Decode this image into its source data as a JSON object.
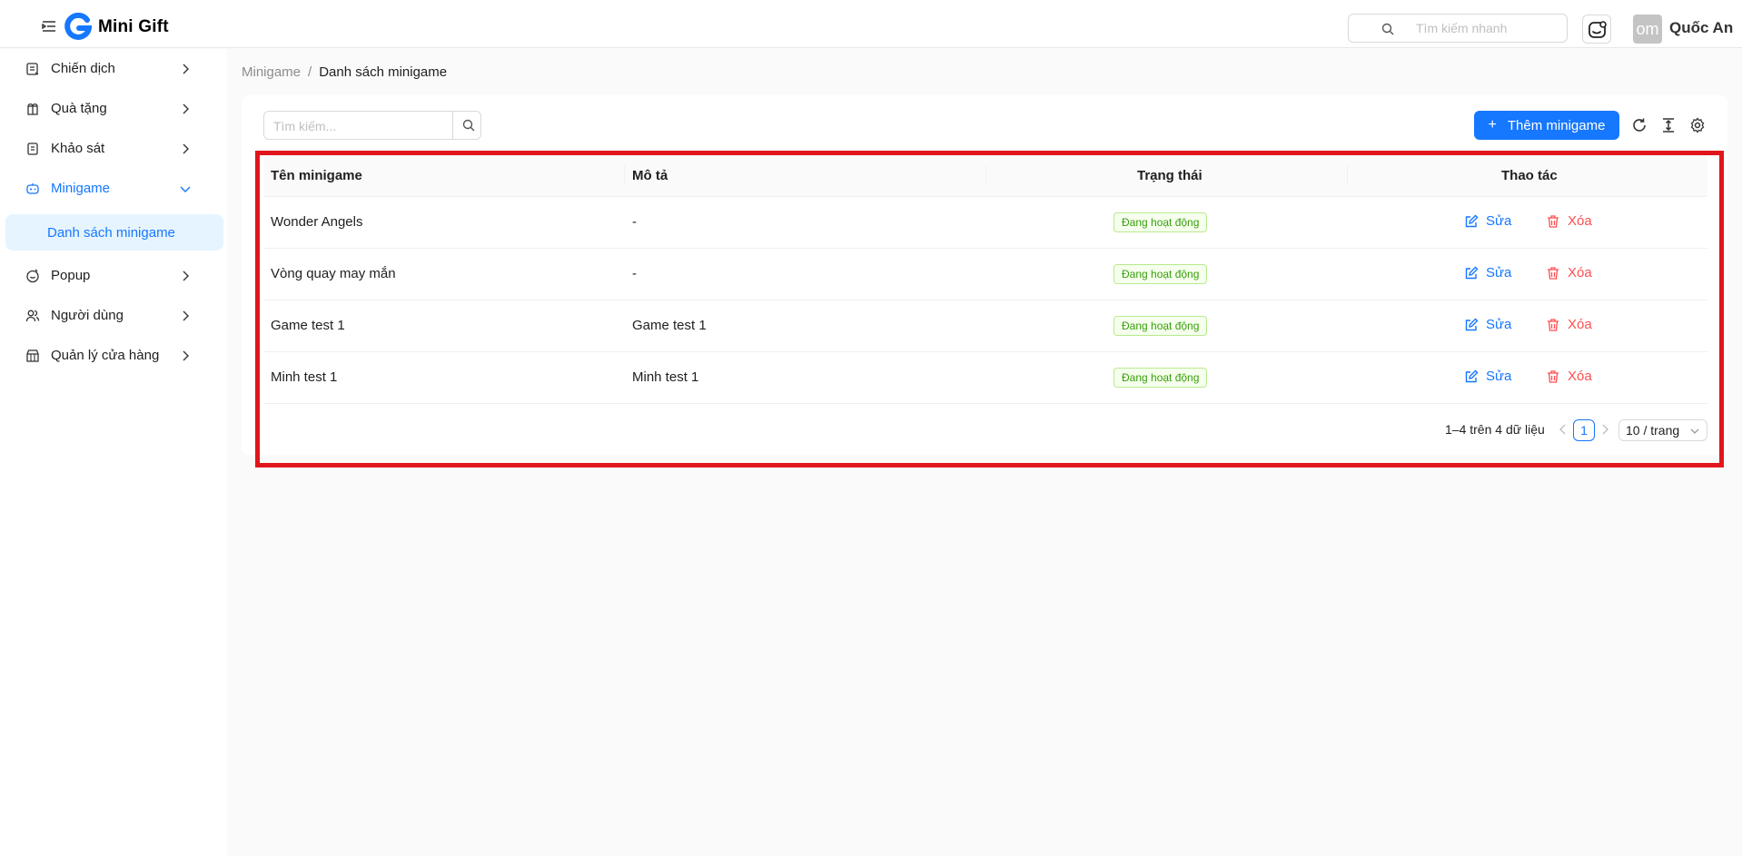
{
  "header": {
    "app_title": "Mini Gift",
    "quick_search_placeholder": "Tìm kiếm nhanh",
    "avatar_initials": "om",
    "user_name": "Quốc An"
  },
  "sidebar": {
    "items": [
      {
        "label": "Chiến dịch",
        "icon": "campaign-icon"
      },
      {
        "label": "Quà tặng",
        "icon": "gift-icon"
      },
      {
        "label": "Khảo sát",
        "icon": "survey-icon"
      },
      {
        "label": "Minigame",
        "icon": "game-icon",
        "active": true,
        "expanded": true
      },
      {
        "label": "Popup",
        "icon": "popup-icon"
      },
      {
        "label": "Người dùng",
        "icon": "users-icon"
      },
      {
        "label": "Quản lý cửa hàng",
        "icon": "store-icon"
      }
    ],
    "sub_item": "Danh sách minigame"
  },
  "breadcrumb": {
    "parent": "Minigame",
    "separator": "/",
    "current": "Danh sách minigame"
  },
  "toolbar": {
    "search_placeholder": "Tìm kiếm...",
    "add_label": "Thêm minigame",
    "add_symbol": "+"
  },
  "table": {
    "columns": [
      "Tên minigame",
      "Mô tả",
      "Trạng thái",
      "Thao tác"
    ],
    "rows": [
      {
        "name": "Wonder Angels",
        "description": "-",
        "status": "Đang hoạt động"
      },
      {
        "name": "Vòng quay may mắn",
        "description": "-",
        "status": "Đang hoạt động"
      },
      {
        "name": "Game test 1",
        "description": "Game test 1",
        "status": "Đang hoạt động"
      },
      {
        "name": "Minh test 1",
        "description": "Minh test 1",
        "status": "Đang hoạt động"
      }
    ],
    "edit_label": "Sửa",
    "delete_label": "Xóa"
  },
  "pagination": {
    "summary": "1–4 trên 4 dữ liệu",
    "current_page": "1",
    "page_size": "10 / trang"
  },
  "colors": {
    "primary": "#1677ff",
    "danger": "#ff4d4f",
    "success": "#389e0d",
    "highlight": "#e0161c"
  }
}
